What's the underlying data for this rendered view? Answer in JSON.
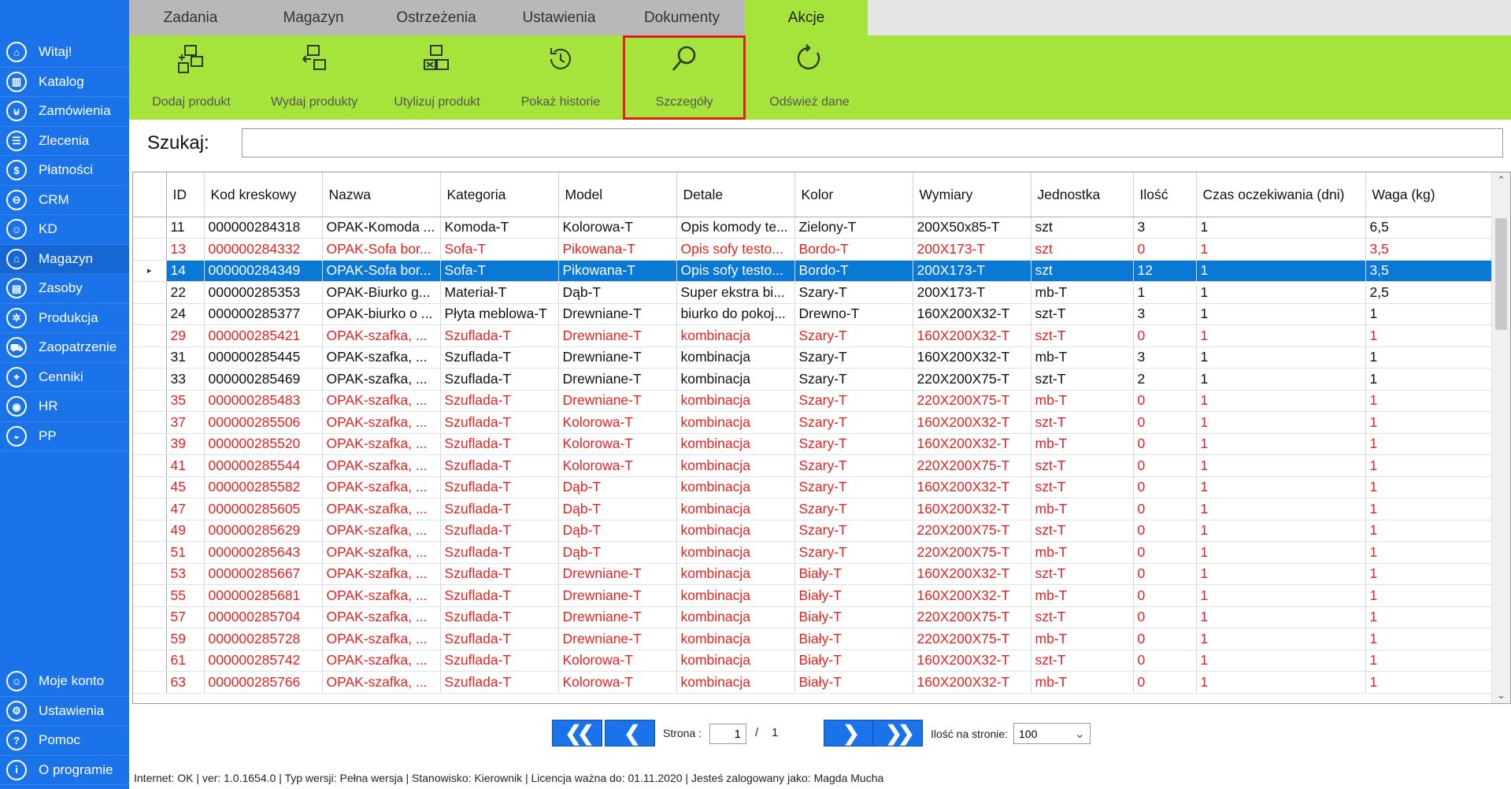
{
  "sidebar": {
    "top_items": [
      {
        "label": "Witaj!",
        "icon": "home-icon",
        "glyph": "⌂"
      },
      {
        "label": "Katalog",
        "icon": "book-icon",
        "glyph": "▥"
      },
      {
        "label": "Zamówienia",
        "icon": "cart-icon",
        "glyph": "⊌"
      },
      {
        "label": "Zlecenia",
        "icon": "list-icon",
        "glyph": "☰"
      },
      {
        "label": "Płatności",
        "icon": "dollar-icon",
        "glyph": "$"
      },
      {
        "label": "CRM",
        "icon": "crm-icon",
        "glyph": "⊖"
      },
      {
        "label": "KD",
        "icon": "user-icon",
        "glyph": "☺"
      },
      {
        "label": "Magazyn",
        "icon": "warehouse-icon",
        "glyph": "⌂"
      },
      {
        "label": "Zasoby",
        "icon": "resources-icon",
        "glyph": "▤"
      },
      {
        "label": "Produkcja",
        "icon": "production-icon",
        "glyph": "✲"
      },
      {
        "label": "Zaopatrzenie",
        "icon": "truck-icon",
        "glyph": "⛟"
      },
      {
        "label": "Cenniki",
        "icon": "tag-icon",
        "glyph": "⌖"
      },
      {
        "label": "HR",
        "icon": "hr-icon",
        "glyph": "◉"
      },
      {
        "label": "PP",
        "icon": "pp-icon",
        "glyph": "◒"
      }
    ],
    "active_index": 7,
    "bottom_items": [
      {
        "label": "Moje konto",
        "icon": "account-icon",
        "glyph": "☺"
      },
      {
        "label": "Ustawienia",
        "icon": "gear-icon",
        "glyph": "⚙"
      },
      {
        "label": "Pomoc",
        "icon": "help-icon",
        "glyph": "?"
      },
      {
        "label": "O programie",
        "icon": "info-icon",
        "glyph": "i"
      }
    ]
  },
  "tabs": [
    "Zadania",
    "Magazyn",
    "Ostrzeżenia",
    "Ustawienia",
    "Dokumenty",
    "Akcje"
  ],
  "active_tab": "Akcje",
  "ribbon": [
    {
      "label": "Dodaj produkt",
      "icon": "add-product-icon"
    },
    {
      "label": "Wydaj produkty",
      "icon": "issue-products-icon"
    },
    {
      "label": "Utylizuj produkt",
      "icon": "dispose-product-icon"
    },
    {
      "label": "Pokaż historie",
      "icon": "history-icon"
    },
    {
      "label": "Szczegóły",
      "icon": "search-details-icon"
    },
    {
      "label": "Odśwież dane",
      "icon": "refresh-icon"
    }
  ],
  "highlight_color": "#e11d1d",
  "accent_green": "#a6e43c",
  "accent_blue": "#1a73e8",
  "search": {
    "label": "Szukaj:",
    "value": "",
    "placeholder": ""
  },
  "table": {
    "columns": [
      "ID",
      "Kod kreskowy",
      "Nazwa",
      "Kategoria",
      "Model",
      "Detale",
      "Kolor",
      "Wymiary",
      "Jednostka",
      "Ilość",
      "Czas oczekiwania (dni)",
      "Waga (kg)"
    ],
    "selected_marker": "▸",
    "rows": [
      {
        "status": "normal",
        "cells": [
          "11",
          "000000284318",
          "OPAK-Komoda ...",
          "Komoda-T",
          "Kolorowa-T",
          "Opis komody te...",
          "Zielony-T",
          "200X50x85-T",
          "szt",
          "3",
          "1",
          "6,5"
        ]
      },
      {
        "status": "red",
        "cells": [
          "13",
          "000000284332",
          "OPAK-Sofa bor...",
          "Sofa-T",
          "Pikowana-T",
          "Opis sofy testo...",
          "Bordo-T",
          "200X173-T",
          "szt",
          "0",
          "1",
          "3,5"
        ]
      },
      {
        "status": "selected",
        "cells": [
          "14",
          "000000284349",
          "OPAK-Sofa bor...",
          "Sofa-T",
          "Pikowana-T",
          "Opis sofy testo...",
          "Bordo-T",
          "200X173-T",
          "szt",
          "12",
          "1",
          "3,5"
        ]
      },
      {
        "status": "normal",
        "cells": [
          "22",
          "000000285353",
          "OPAK-Biurko g...",
          "Materiał-T",
          "Dąb-T",
          "Super ekstra bi...",
          "Szary-T",
          "200X173-T",
          "mb-T",
          "1",
          "1",
          "2,5"
        ]
      },
      {
        "status": "normal",
        "cells": [
          "24",
          "000000285377",
          "OPAK-biurko o ...",
          "Płyta meblowa-T",
          "Drewniane-T",
          "biurko do pokoj...",
          "Drewno-T",
          "160X200X32-T",
          "szt-T",
          "3",
          "1",
          "1"
        ]
      },
      {
        "status": "red",
        "cells": [
          "29",
          "000000285421",
          "OPAK-szafka, ...",
          "Szuflada-T",
          "Drewniane-T",
          "kombinacja",
          "Szary-T",
          "160X200X32-T",
          "szt-T",
          "0",
          "1",
          "1"
        ]
      },
      {
        "status": "normal",
        "cells": [
          "31",
          "000000285445",
          "OPAK-szafka, ...",
          "Szuflada-T",
          "Drewniane-T",
          "kombinacja",
          "Szary-T",
          "160X200X32-T",
          "mb-T",
          "3",
          "1",
          "1"
        ]
      },
      {
        "status": "normal",
        "cells": [
          "33",
          "000000285469",
          "OPAK-szafka, ...",
          "Szuflada-T",
          "Drewniane-T",
          "kombinacja",
          "Szary-T",
          "220X200X75-T",
          "szt-T",
          "2",
          "1",
          "1"
        ]
      },
      {
        "status": "red",
        "cells": [
          "35",
          "000000285483",
          "OPAK-szafka, ...",
          "Szuflada-T",
          "Drewniane-T",
          "kombinacja",
          "Szary-T",
          "220X200X75-T",
          "mb-T",
          "0",
          "1",
          "1"
        ]
      },
      {
        "status": "red",
        "cells": [
          "37",
          "000000285506",
          "OPAK-szafka, ...",
          "Szuflada-T",
          "Kolorowa-T",
          "kombinacja",
          "Szary-T",
          "160X200X32-T",
          "szt-T",
          "0",
          "1",
          "1"
        ]
      },
      {
        "status": "red",
        "cells": [
          "39",
          "000000285520",
          "OPAK-szafka, ...",
          "Szuflada-T",
          "Kolorowa-T",
          "kombinacja",
          "Szary-T",
          "160X200X32-T",
          "mb-T",
          "0",
          "1",
          "1"
        ]
      },
      {
        "status": "red",
        "cells": [
          "41",
          "000000285544",
          "OPAK-szafka, ...",
          "Szuflada-T",
          "Kolorowa-T",
          "kombinacja",
          "Szary-T",
          "220X200X75-T",
          "szt-T",
          "0",
          "1",
          "1"
        ]
      },
      {
        "status": "red",
        "cells": [
          "45",
          "000000285582",
          "OPAK-szafka, ...",
          "Szuflada-T",
          "Dąb-T",
          "kombinacja",
          "Szary-T",
          "160X200X32-T",
          "szt-T",
          "0",
          "1",
          "1"
        ]
      },
      {
        "status": "red",
        "cells": [
          "47",
          "000000285605",
          "OPAK-szafka, ...",
          "Szuflada-T",
          "Dąb-T",
          "kombinacja",
          "Szary-T",
          "160X200X32-T",
          "mb-T",
          "0",
          "1",
          "1"
        ]
      },
      {
        "status": "red",
        "cells": [
          "49",
          "000000285629",
          "OPAK-szafka, ...",
          "Szuflada-T",
          "Dąb-T",
          "kombinacja",
          "Szary-T",
          "220X200X75-T",
          "szt-T",
          "0",
          "1",
          "1"
        ]
      },
      {
        "status": "red",
        "cells": [
          "51",
          "000000285643",
          "OPAK-szafka, ...",
          "Szuflada-T",
          "Dąb-T",
          "kombinacja",
          "Szary-T",
          "220X200X75-T",
          "mb-T",
          "0",
          "1",
          "1"
        ]
      },
      {
        "status": "red",
        "cells": [
          "53",
          "000000285667",
          "OPAK-szafka, ...",
          "Szuflada-T",
          "Drewniane-T",
          "kombinacja",
          "Biały-T",
          "160X200X32-T",
          "szt-T",
          "0",
          "1",
          "1"
        ]
      },
      {
        "status": "red",
        "cells": [
          "55",
          "000000285681",
          "OPAK-szafka, ...",
          "Szuflada-T",
          "Drewniane-T",
          "kombinacja",
          "Biały-T",
          "160X200X32-T",
          "mb-T",
          "0",
          "1",
          "1"
        ]
      },
      {
        "status": "red",
        "cells": [
          "57",
          "000000285704",
          "OPAK-szafka, ...",
          "Szuflada-T",
          "Drewniane-T",
          "kombinacja",
          "Biały-T",
          "220X200X75-T",
          "szt-T",
          "0",
          "1",
          "1"
        ]
      },
      {
        "status": "red",
        "cells": [
          "59",
          "000000285728",
          "OPAK-szafka, ...",
          "Szuflada-T",
          "Drewniane-T",
          "kombinacja",
          "Biały-T",
          "220X200X75-T",
          "mb-T",
          "0",
          "1",
          "1"
        ]
      },
      {
        "status": "red",
        "cells": [
          "61",
          "000000285742",
          "OPAK-szafka, ...",
          "Szuflada-T",
          "Kolorowa-T",
          "kombinacja",
          "Biały-T",
          "160X200X32-T",
          "szt-T",
          "0",
          "1",
          "1"
        ]
      },
      {
        "status": "red",
        "cells": [
          "63",
          "000000285766",
          "OPAK-szafka, ...",
          "Szuflada-T",
          "Kolorowa-T",
          "kombinacja",
          "Biały-T",
          "160X200X32-T",
          "mb-T",
          "0",
          "1",
          "1"
        ]
      }
    ]
  },
  "pagination": {
    "first": "❮❮",
    "prev": "❮",
    "next": "❯",
    "last": "❯❯",
    "page_label": "Strona :",
    "current_page": "1",
    "slash": "/",
    "total_pages": "1",
    "per_page_label": "Ilość na stronie:",
    "per_page_value": "100",
    "dropdown_glyph": "⌄"
  },
  "status_bar": "Internet: OK  |  ver: 1.0.1654.0  |  Typ wersji: Pełna wersja  |  Stanowisko: Kierownik  |  Licencja ważna do: 01.11.2020  |  Jesteś zalogowany jako: Magda Mucha"
}
